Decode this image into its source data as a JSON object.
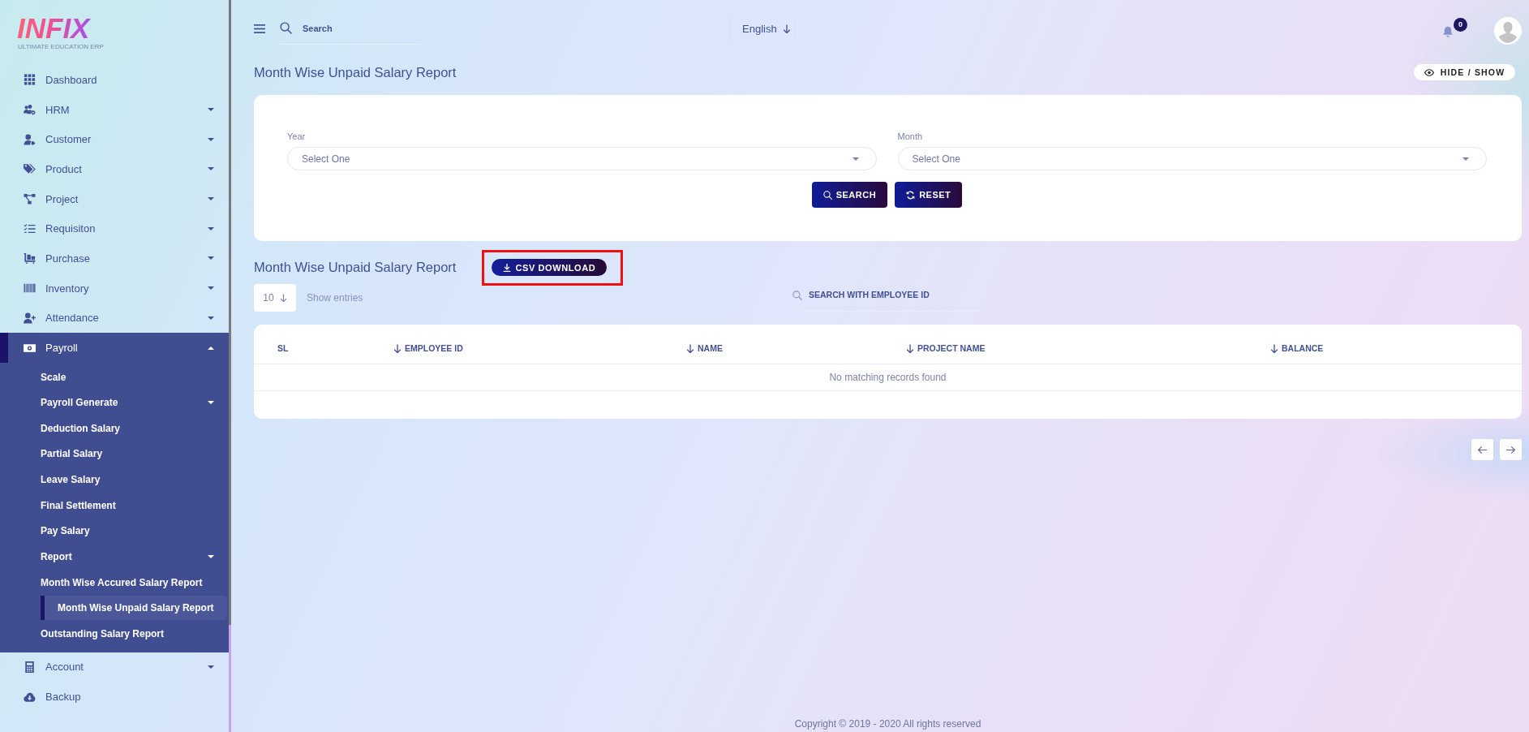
{
  "sidebar": {
    "logo": {
      "title": "INFIX",
      "subtitle": "ULTIMATE EDUCATION ERP"
    },
    "items": [
      {
        "label": "Dashboard",
        "kind": "link",
        "selected": false
      },
      {
        "label": "HRM",
        "kind": "menu",
        "expanded": false,
        "selected": false
      },
      {
        "label": "Customer",
        "kind": "menu",
        "expanded": false,
        "selected": false
      },
      {
        "label": "Product",
        "kind": "menu",
        "expanded": false,
        "selected": false
      },
      {
        "label": "Project",
        "kind": "menu",
        "expanded": false,
        "selected": false
      },
      {
        "label": "Requisiton",
        "kind": "menu",
        "expanded": false,
        "selected": false
      },
      {
        "label": "Purchase",
        "kind": "menu",
        "expanded": false,
        "selected": false
      },
      {
        "label": "Inventory",
        "kind": "menu",
        "expanded": false,
        "selected": false
      },
      {
        "label": "Attendance",
        "kind": "menu",
        "expanded": false,
        "selected": false
      },
      {
        "label": "Payroll",
        "kind": "menu",
        "expanded": true,
        "selected": true,
        "children": [
          {
            "label": "Scale",
            "kind": "link",
            "selected": false
          },
          {
            "label": "Payroll Generate",
            "kind": "menu",
            "expanded": false,
            "selected": false
          },
          {
            "label": "Deduction Salary",
            "kind": "link",
            "selected": false
          },
          {
            "label": "Partial Salary",
            "kind": "link",
            "selected": false
          },
          {
            "label": "Leave Salary",
            "kind": "link",
            "selected": false
          },
          {
            "label": "Final Settlement",
            "kind": "link",
            "selected": false
          },
          {
            "label": "Pay Salary",
            "kind": "link",
            "selected": false
          },
          {
            "label": "Report",
            "kind": "menu",
            "expanded": false,
            "selected": false
          },
          {
            "label": "Month Wise Accured Salary Report",
            "kind": "link",
            "selected": false
          },
          {
            "label": "Month Wise Unpaid Salary Report",
            "kind": "link",
            "selected": true
          },
          {
            "label": "Outstanding Salary Report",
            "kind": "link",
            "selected": false
          }
        ]
      },
      {
        "label": "Account",
        "kind": "menu",
        "expanded": false,
        "selected": false
      },
      {
        "label": "Backup",
        "kind": "link",
        "selected": false
      }
    ]
  },
  "topbar": {
    "search": {
      "placeholder": "Search"
    },
    "language": "English",
    "notification_count": "0"
  },
  "page_header": {
    "title": "Month Wise Unpaid Salary Report",
    "toggle_button": "HIDE / SHOW"
  },
  "filter": {
    "fields": [
      {
        "label": "Year",
        "placeholder": "Select One"
      },
      {
        "label": "Month",
        "placeholder": "Select One"
      }
    ],
    "buttons": [
      {
        "label": "SEARCH"
      },
      {
        "label": "RESET"
      }
    ]
  },
  "report": {
    "title": "Month Wise Unpaid Salary Report",
    "csv_button": {
      "label": "CSV DOWNLOAD",
      "highlighted": true
    },
    "page_size": "10",
    "page_size_label": "Show entries",
    "search": {
      "placeholder": "SEARCH WITH EMPLOYEE ID"
    },
    "table": {
      "columns": [
        {
          "label": "SL",
          "sortable": false
        },
        {
          "label": "EMPLOYEE ID",
          "sortable": true
        },
        {
          "label": "NAME",
          "sortable": true
        },
        {
          "label": "PROJECT NAME",
          "sortable": true
        },
        {
          "label": "BALANCE",
          "sortable": true
        }
      ],
      "empty_message": "No matching records found"
    }
  },
  "footer": {
    "text": "Copyright © 2019 - 2020 All rights reserved"
  }
}
